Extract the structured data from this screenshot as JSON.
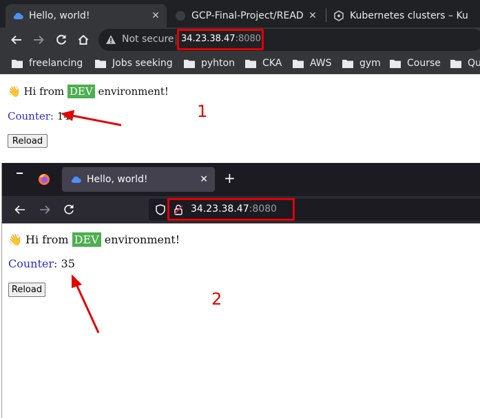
{
  "chrome": {
    "tabs": [
      {
        "title": "Hello, world!",
        "active": true
      },
      {
        "title": "GCP-Final-Project/READ",
        "active": false
      },
      {
        "title": "Kubernetes clusters – Ku",
        "active": false
      }
    ],
    "security_label": "Not secure",
    "url_host": "34.23.38.47",
    "url_port": ":8080",
    "bookmarks": [
      "freelancing",
      "Jobs seeking",
      "pyhton",
      "CKA",
      "AWS",
      "gym",
      "Course",
      "Qu"
    ],
    "page": {
      "wave": "👋",
      "greeting_pre": "Hi from",
      "env": "DEV",
      "greeting_post": "environment!",
      "counter_label": "Counter:",
      "counter_value": "14",
      "reload_label": "Reload"
    },
    "annotation": "1"
  },
  "firefox": {
    "tab_title": "Hello, world!",
    "url_host": "34.23.38.47",
    "url_port": ":8080",
    "page": {
      "wave": "👋",
      "greeting_pre": "Hi from",
      "env": "DEV",
      "greeting_post": "environment!",
      "counter_label": "Counter:",
      "counter_value": "35",
      "reload_label": "Reload"
    },
    "annotation": "2"
  },
  "colors": {
    "annotation_red": "#e30000",
    "dev_badge": "#4caf50",
    "counter_label": "#2a2ad4"
  }
}
